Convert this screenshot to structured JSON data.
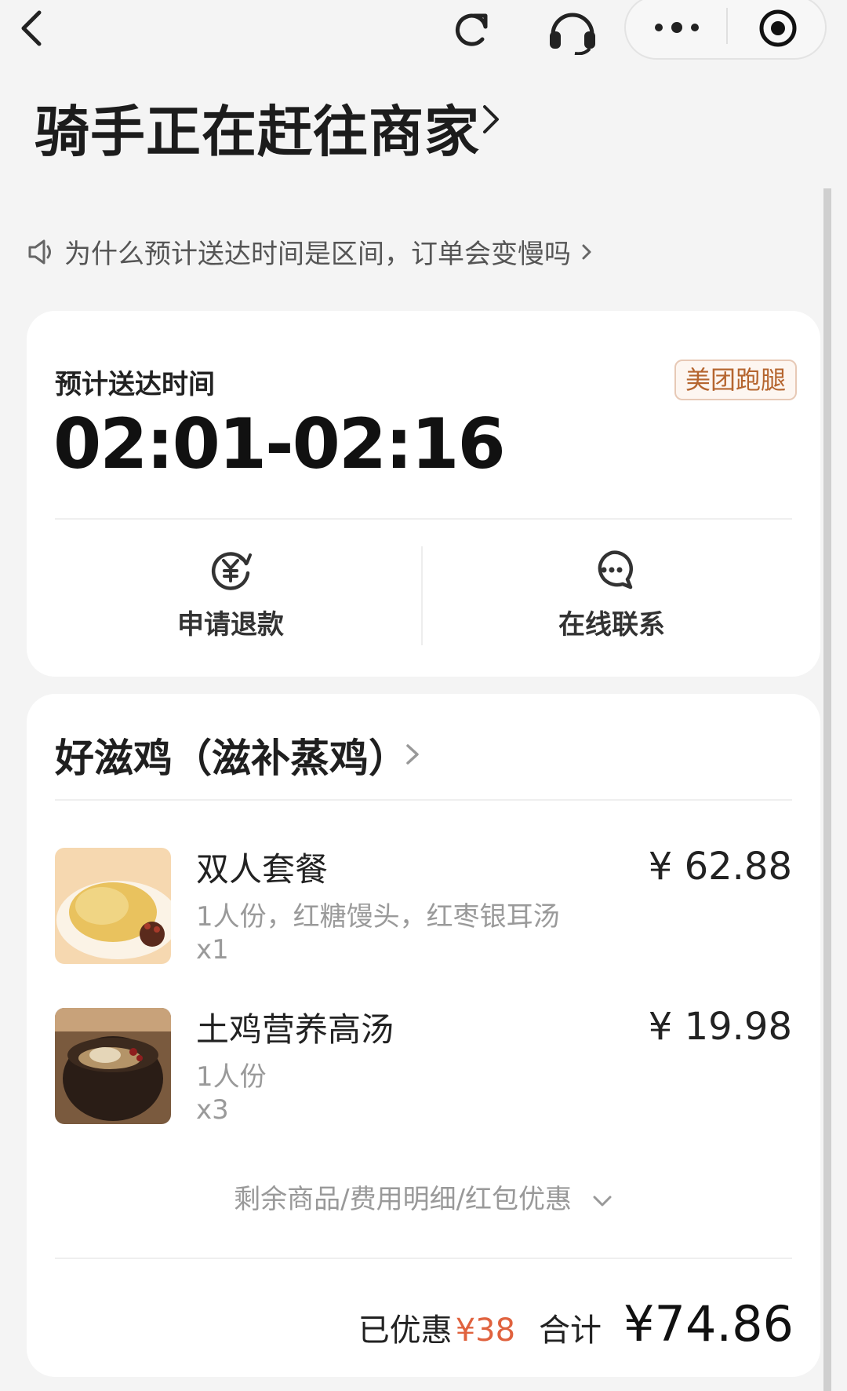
{
  "status": {
    "title": "骑手正在赶往商家"
  },
  "notice": {
    "text": "为什么预计送达时间是区间，订单会变慢吗"
  },
  "eta": {
    "label": "预计送达时间",
    "time": "02:01-02:16",
    "tag": "美团跑腿"
  },
  "actions": [
    {
      "label": "申请退款",
      "icon": "refund-icon"
    },
    {
      "label": "在线联系",
      "icon": "chat-icon"
    }
  ],
  "shop": {
    "name": "好滋鸡（滋补蒸鸡）"
  },
  "items": [
    {
      "name": "双人套餐",
      "spec": "1人份，红糖馒头，红枣银耳汤",
      "qty": "x1",
      "price": "¥ 62.88"
    },
    {
      "name": "土鸡营养高汤",
      "spec": "1人份",
      "qty": "x3",
      "price": "¥ 19.98"
    }
  ],
  "more_link": "剩余商品/费用明细/红包优惠",
  "totals": {
    "discount_label": "已优惠",
    "discount": "¥38",
    "total_label": "合计",
    "total": "¥74.86"
  },
  "colors": {
    "accent_discount": "#e0623e",
    "tag_text": "#b5652f"
  }
}
